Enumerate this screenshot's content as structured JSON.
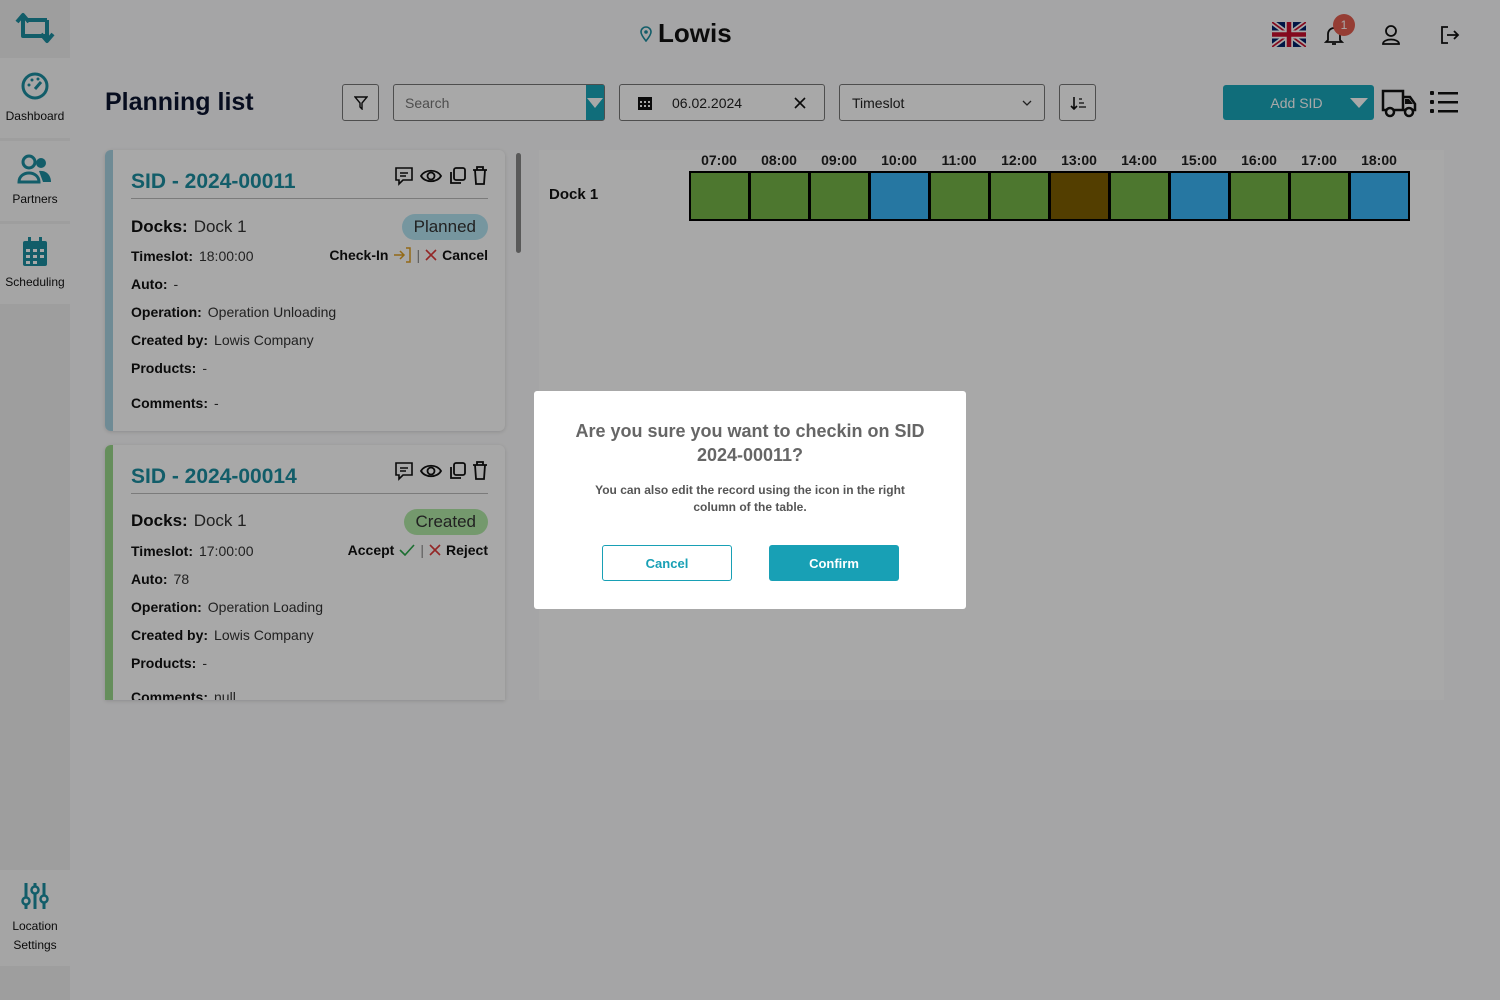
{
  "app": {
    "title": "Lowis",
    "notifications": "1"
  },
  "sidebar": {
    "items": [
      {
        "label": "Dashboard"
      },
      {
        "label": "Partners"
      },
      {
        "label": "Scheduling"
      }
    ],
    "bottom": {
      "label_line1": "Location",
      "label_line2": "Settings"
    }
  },
  "page": {
    "title": "Planning list"
  },
  "toolbar": {
    "search_placeholder": "Search",
    "date": "06.02.2024",
    "sort_select": "Timeslot",
    "add_label": "Add SID"
  },
  "cards": [
    {
      "sid": "SID - 2024-00011",
      "docks_label": "Docks:",
      "docks": "Dock 1",
      "status": "Planned",
      "timeslot_label": "Timeslot:",
      "timeslot": "18:00:00",
      "action1": "Check-In",
      "action2": "Cancel",
      "auto_label": "Auto:",
      "auto": "-",
      "operation_label": "Operation:",
      "operation": "Operation Unloading",
      "created_label": "Created by:",
      "created": "Lowis Company",
      "products_label": "Products:",
      "products": "-",
      "comments_label": "Comments:",
      "comments": "-",
      "stripe": "#a9d3e3",
      "status_color": "#b4e4f2"
    },
    {
      "sid": "SID - 2024-00014",
      "docks_label": "Docks:",
      "docks": "Dock 1",
      "status": "Created",
      "timeslot_label": "Timeslot:",
      "timeslot": "17:00:00",
      "action1": "Accept",
      "action2": "Reject",
      "auto_label": "Auto:",
      "auto": "78",
      "operation_label": "Operation:",
      "operation": "Operation Loading",
      "created_label": "Created by:",
      "created": "Lowis Company",
      "products_label": "Products:",
      "products": "-",
      "comments_label": "Comments:",
      "comments": "null",
      "stripe": "#9ad88a",
      "status_color": "#b0e8a6"
    }
  ],
  "timeline": {
    "dock": "Dock 1",
    "hours": [
      "07:00",
      "08:00",
      "09:00",
      "10:00",
      "11:00",
      "12:00",
      "13:00",
      "14:00",
      "15:00",
      "16:00",
      "17:00",
      "18:00"
    ],
    "slots": [
      "green",
      "green",
      "green",
      "blue",
      "green",
      "green",
      "brown",
      "green",
      "blue",
      "green",
      "green",
      "blue"
    ],
    "colors": {
      "green": "#75b548",
      "blue": "#3ab5f6",
      "brown": "#7e5f00"
    }
  },
  "modal": {
    "title": "Are you sure you want to checkin on SID 2024-00011?",
    "subtitle": "You can also edit the record using the icon in the right column of the table.",
    "cancel": "Cancel",
    "confirm": "Confirm"
  }
}
